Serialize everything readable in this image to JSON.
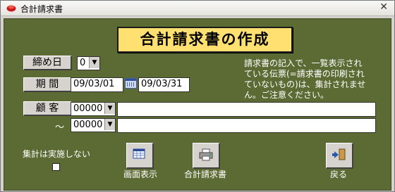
{
  "window": {
    "title": "合計請求書",
    "close_glyph": "✕"
  },
  "banner": {
    "title": "合計請求書の作成"
  },
  "cutoff": {
    "label": "締め日",
    "value": "0"
  },
  "period": {
    "label": "期 間",
    "from": "09/03/01",
    "to": "09/03/31"
  },
  "customer": {
    "label": "顧 客",
    "from_code": "00000",
    "from_name": "",
    "tilde": "～",
    "to_code": "00000",
    "to_name": ""
  },
  "notice": {
    "lines": [
      "請求書の記入で、一覧表示され",
      "ている伝票(=請求書の印刷され",
      "ていないもの)は、集計されませ",
      "ん。ご注意ください。"
    ]
  },
  "options": {
    "no_aggregate_label": "集計は実施しない",
    "no_aggregate_checked": false
  },
  "buttons": {
    "screen_display": "画面表示",
    "invoice_print": "合計請求書",
    "back": "戻る"
  },
  "colors": {
    "panel": "#5c6b34",
    "banner": "#ffe070",
    "face": "#d6d3ce"
  },
  "icons": {
    "app": "red-app-icon",
    "calendar": "calendar-icon",
    "screen": "table-view-icon",
    "printer": "printer-icon",
    "back": "door-exit-icon"
  }
}
